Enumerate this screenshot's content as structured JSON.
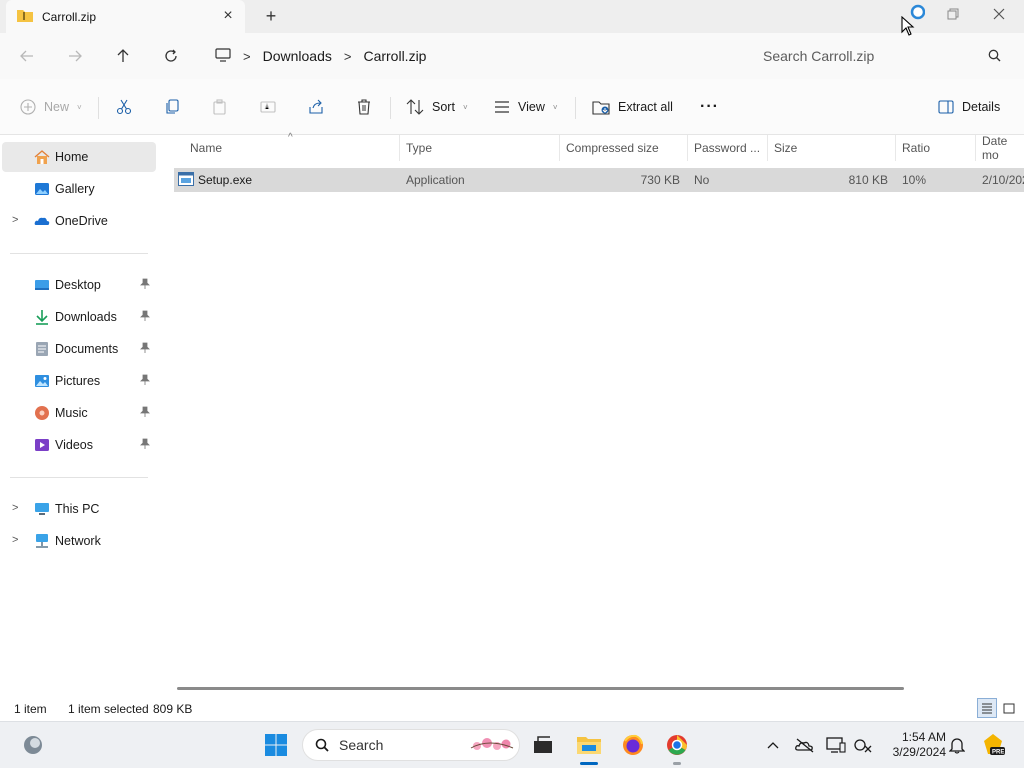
{
  "window": {
    "tab_title": "Carroll.zip",
    "tab_icon": "zip-folder-icon",
    "new_tab": "+",
    "close_tab": "×"
  },
  "address": {
    "crumbs": [
      "Downloads",
      "Carroll.zip"
    ],
    "search_placeholder": "Search Carroll.zip"
  },
  "commands": {
    "new_label": "New",
    "sort_label": "Sort",
    "view_label": "View",
    "extract_label": "Extract all",
    "more_label": "···",
    "details_label": "Details"
  },
  "sidebar": {
    "top": [
      {
        "label": "Home",
        "icon": "home-icon",
        "active": true
      },
      {
        "label": "Gallery",
        "icon": "gallery-icon"
      },
      {
        "label": "OneDrive",
        "icon": "onedrive-icon"
      }
    ],
    "pinned": [
      {
        "label": "Desktop",
        "icon": "desktop-icon"
      },
      {
        "label": "Downloads",
        "icon": "downloads-icon"
      },
      {
        "label": "Documents",
        "icon": "documents-icon"
      },
      {
        "label": "Pictures",
        "icon": "pictures-icon"
      },
      {
        "label": "Music",
        "icon": "music-icon"
      },
      {
        "label": "Videos",
        "icon": "videos-icon"
      }
    ],
    "bottom": [
      {
        "label": "This PC",
        "icon": "this-pc-icon"
      },
      {
        "label": "Network",
        "icon": "network-icon"
      }
    ]
  },
  "table": {
    "columns": [
      "Name",
      "Type",
      "Compressed size",
      "Password ...",
      "Size",
      "Ratio",
      "Date mo"
    ],
    "rows": [
      {
        "name": "Setup.exe",
        "type": "Application",
        "compressed": "730 KB",
        "password": "No",
        "size": "810 KB",
        "ratio": "10%",
        "date": "2/10/202"
      }
    ]
  },
  "status": {
    "count": "1 item",
    "selected": "1 item selected",
    "selected_size": "809 KB"
  },
  "taskbar": {
    "search_label": "Search",
    "time": "1:54 AM",
    "date": "3/29/2024"
  },
  "colors": {
    "accent": "#0067c0",
    "selected_row": "#d9d9d9",
    "sidebar_active": "#e9e9e9",
    "folder_yellow": "#f5c342"
  }
}
